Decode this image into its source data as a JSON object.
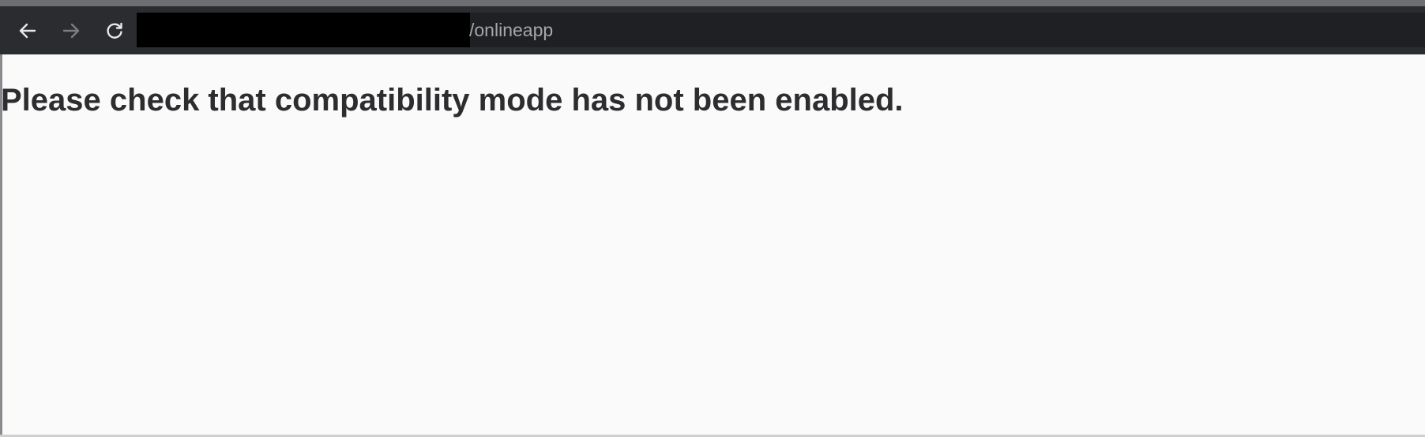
{
  "browser": {
    "toolbar": {
      "back": {
        "icon": "arrow-left-icon",
        "enabled": true
      },
      "forward": {
        "icon": "arrow-right-icon",
        "enabled": false
      },
      "reload": {
        "icon": "reload-icon"
      }
    },
    "address_bar": {
      "url_visible_suffix": "/onlineapp",
      "redacted": true
    }
  },
  "page": {
    "message": "Please check that compatibility mode has not been enabled."
  },
  "colors": {
    "toolbar_bg": "#2b2c30",
    "address_bg": "#1f2023",
    "url_text": "#a6a7ab",
    "page_bg": "#fafafa",
    "message_text": "#2d2d30"
  }
}
